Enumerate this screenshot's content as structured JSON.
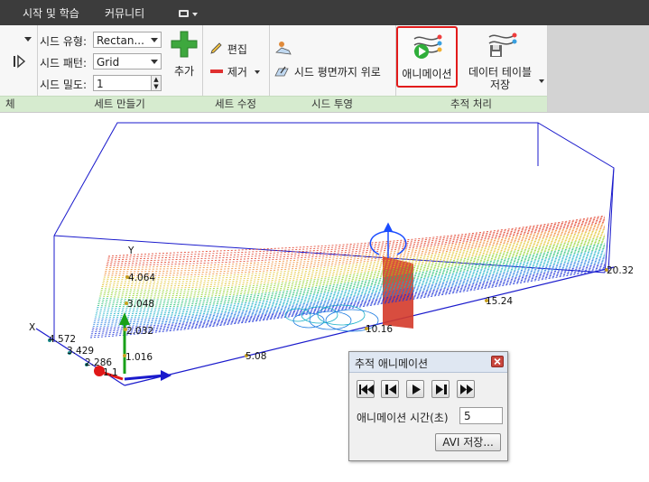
{
  "menu": {
    "items": [
      "시작 및 학습",
      "커뮤니티"
    ]
  },
  "ribbon": {
    "seed_type_label": "시드 유형:",
    "seed_type_value": "Rectan...",
    "seed_pattern_label": "시드 패턴:",
    "seed_pattern_value": "Grid",
    "seed_density_label": "시드 밀도:",
    "seed_density_value": "1",
    "add_label": "추가",
    "edit_label": "편집",
    "remove_label": "제거",
    "project_label": "시드 평면까지 위로",
    "animation_label": "애니메이션",
    "data_table_label_1": "데이터 테이블",
    "data_table_label_2": "저장",
    "groups": {
      "create": "세트 만들기",
      "modify": "세트 수정",
      "project": "시드 투영",
      "trace": "추적 처리"
    },
    "cut_group_label": "체"
  },
  "viewport": {
    "axis_x": "X",
    "axis_y": "Y",
    "y_ticks": [
      "4.064",
      "3.048",
      "2.032",
      "1.016"
    ],
    "z_ticks": [
      "4.572",
      "3.429",
      "2.286",
      "1.1"
    ],
    "x_ticks": [
      "5.08",
      "10.16",
      "15.24",
      "20.32"
    ]
  },
  "dialog": {
    "title": "추적 애니메이션",
    "time_label": "애니메이션 시간(초)",
    "time_value": "5",
    "avi_button": "AVI 저장..."
  },
  "colors": {
    "topbar": "#3c3c3c",
    "ribbon_footer": "#d6ebcf",
    "highlight": "#e21b1b",
    "box_edge": "#1a1acc",
    "seed_plane": "#d43a2a"
  }
}
